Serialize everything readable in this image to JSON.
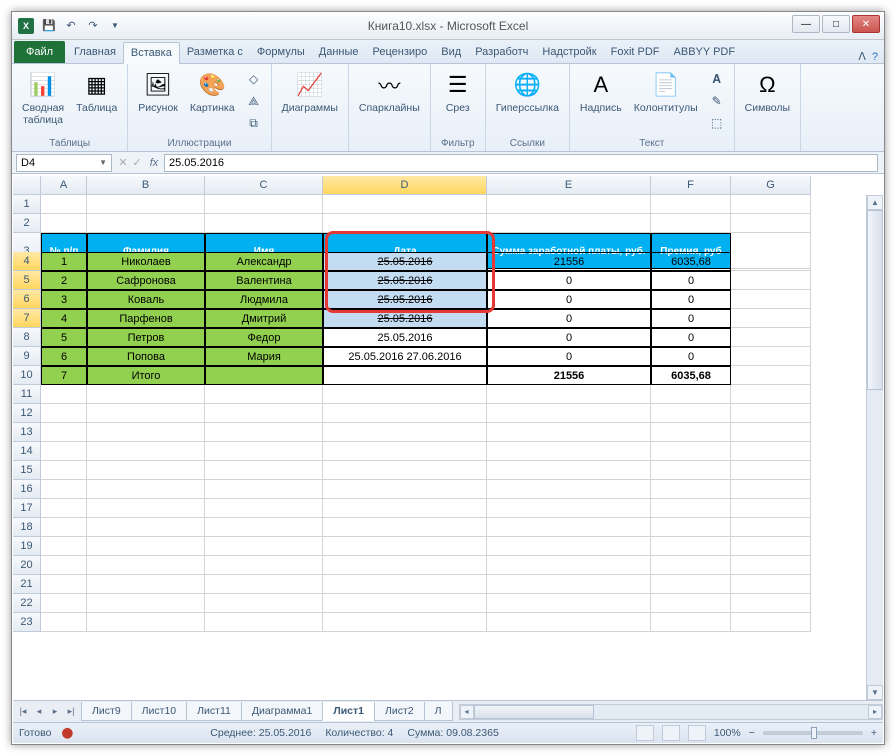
{
  "title": "Книга10.xlsx - Microsoft Excel",
  "ribbon": {
    "file": "Файл",
    "tabs": [
      "Главная",
      "Вставка",
      "Разметка с",
      "Формулы",
      "Данные",
      "Рецензиро",
      "Вид",
      "Разработч",
      "Надстройк",
      "Foxit PDF",
      "ABBYY PDF"
    ],
    "groups": {
      "tables": {
        "label": "Таблицы",
        "pivot": "Сводная\nтаблица",
        "table": "Таблица"
      },
      "illustrations": {
        "label": "Иллюстрации",
        "picture": "Рисунок",
        "clipart": "Картинка"
      },
      "charts": {
        "charts": "Диаграммы"
      },
      "sparklines": {
        "sparklines": "Спарклайны"
      },
      "filter": {
        "label": "Фильтр",
        "slicer": "Срез"
      },
      "links": {
        "label": "Ссылки",
        "hyperlink": "Гиперссылка"
      },
      "text": {
        "label": "Текст",
        "textbox": "Надпись",
        "headerfooter": "Колонтитулы"
      },
      "symbols": {
        "symbols": "Символы"
      }
    }
  },
  "formula_bar": {
    "cell": "D4",
    "value": "25.05.2016"
  },
  "columns": [
    "A",
    "B",
    "C",
    "D",
    "E",
    "F",
    "G"
  ],
  "table": {
    "headers": [
      "№ п/п",
      "Фамилия",
      "Имя",
      "Дата",
      "Сумма заработной платы, руб.",
      "Премия, руб"
    ],
    "rows": [
      {
        "n": "1",
        "fam": "Николаев",
        "name": "Александр",
        "date": "25.05.2016",
        "sum": "21556",
        "prem": "6035,68"
      },
      {
        "n": "2",
        "fam": "Сафронова",
        "name": "Валентина",
        "date": "25.05.2016",
        "sum": "0",
        "prem": "0"
      },
      {
        "n": "3",
        "fam": "Коваль",
        "name": "Людмила",
        "date": "25.05.2016",
        "sum": "0",
        "prem": "0"
      },
      {
        "n": "4",
        "fam": "Парфенов",
        "name": "Дмитрий",
        "date": "25.05.2016",
        "sum": "0",
        "prem": "0"
      },
      {
        "n": "5",
        "fam": "Петров",
        "name": "Федор",
        "date": "25.05.2016",
        "sum": "0",
        "prem": "0"
      },
      {
        "n": "6",
        "fam": "Попова",
        "name": "Мария",
        "date": "25.05.2016 27.06.2016",
        "sum": "0",
        "prem": "0"
      },
      {
        "n": "7",
        "fam": "Итого",
        "name": "",
        "date": "",
        "sum": "21556",
        "prem": "6035,68"
      }
    ]
  },
  "sheets": [
    "Лист9",
    "Лист10",
    "Лист11",
    "Диаграмма1",
    "Лист1",
    "Лист2",
    "Л"
  ],
  "status": {
    "ready": "Готово",
    "avg_label": "Среднее:",
    "avg": "25.05.2016",
    "count_label": "Количество:",
    "count": "4",
    "sum_label": "Сумма:",
    "sum": "09.08.2365",
    "zoom": "100%"
  }
}
